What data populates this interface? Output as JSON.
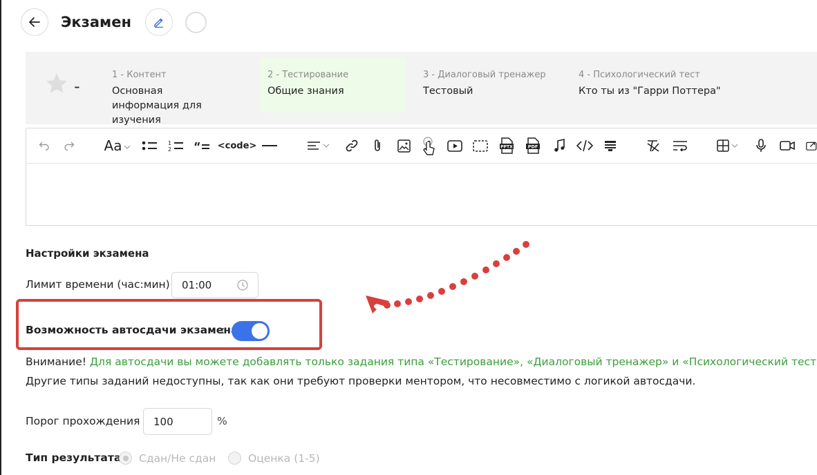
{
  "header": {
    "title": "Экзамен"
  },
  "steps": {
    "rating_dash": "-",
    "items": [
      {
        "num": "1 - Контент",
        "name": "Основная информация для изучения"
      },
      {
        "num": "2 - Тестирование",
        "name": "Общие знания"
      },
      {
        "num": "3 - Диалоговый тренажер",
        "name": "Тестовый"
      },
      {
        "num": "4 - Психологический тест",
        "name": "Кто ты из \"Гарри Поттера\""
      }
    ]
  },
  "toolbar": {
    "font_size_label": "Aa",
    "code_label": "<code>",
    "pptx_label": "PPTX",
    "pdf_label": "PDF"
  },
  "settings": {
    "section_title": "Настройки экзамена",
    "time_limit_label": "Лимит времени (час:мин)",
    "time_limit_value": "01:00",
    "auto_submit_label": "Возможность автосдачи экзамена",
    "auto_submit_colon": ":",
    "auto_submit_enabled": true,
    "notice_prefix": "Внимание!",
    "notice_green": " Для автосдачи вы можете добавлять только задания типа «Тестирование», «Диалоговый тренажер» и «Психологический тест»",
    "notice_line2": "Другие типы заданий недоступны, так как они требуют проверки ментором, что несовместимо с логикой автосдачи.",
    "pass_threshold_label": "Порог прохождения",
    "pass_threshold_value": "100",
    "percent_sign": "%",
    "result_type_label": "Тип результата",
    "result_options": [
      "Сдан/Не сдан",
      "Оценка (1-5)"
    ],
    "result_selected": "Сдан/Не сдан"
  },
  "colors": {
    "accent": "#3c72e8",
    "highlight": "#d8403d",
    "notice_green": "#3a9e3a",
    "active_step_bg": "#eefbe9"
  }
}
